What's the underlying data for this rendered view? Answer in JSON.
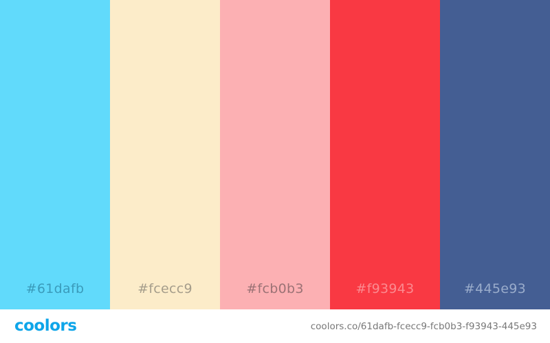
{
  "palette": {
    "swatches": [
      {
        "hex": "#61dafb",
        "label": "#61dafb",
        "text_color": "#3a9bbb"
      },
      {
        "hex": "#fcecc9",
        "label": "#fcecc9",
        "text_color": "#a59d8b"
      },
      {
        "hex": "#fcb0b3",
        "label": "#fcb0b3",
        "text_color": "#9b7275"
      },
      {
        "hex": "#f93943",
        "label": "#f93943",
        "text_color": "#fb8a90"
      },
      {
        "hex": "#445e93",
        "label": "#445e93",
        "text_color": "#9aaccb"
      }
    ]
  },
  "footer": {
    "logo_text": "coolors",
    "logo_color": "#0ea5e9",
    "url_text": "coolors.co/61dafb-fcecc9-fcb0b3-f93943-445e93",
    "url_color": "#777777"
  }
}
